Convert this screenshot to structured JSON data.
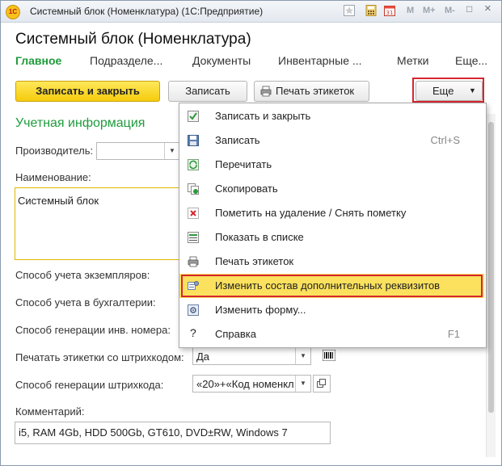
{
  "window": {
    "title": "Системный блок (Номенклатура)  (1С:Предприятие)",
    "toolbar_text": [
      "M",
      "M+",
      "M-"
    ],
    "window_buttons": [
      "□",
      "×"
    ]
  },
  "form": {
    "title": "Системный блок (Номенклатура)",
    "tabs": [
      "Главное",
      "Подразделе...",
      "Документы",
      "Инвентарные ...",
      "Метки",
      "Еще..."
    ]
  },
  "toolbar": {
    "save_close": "Записать и закрыть",
    "save": "Записать",
    "print_labels": "Печать этикеток",
    "more": "Еще"
  },
  "section": {
    "title": "Учетная информация"
  },
  "fields": {
    "manufacturer_label": "Производитель:",
    "name_label": "Наименование:",
    "name_value": "Системный блок",
    "copy_method_label": "Способ учета экземпляров:",
    "accounting_method_label": "Способ учета в бухгалтерии:",
    "inv_gen_label": "Способ генерации инв. номера:",
    "print_barcode_label": "Печатать этикетки со штрихкодом:",
    "print_barcode_value": "Да",
    "barcode_gen_label": "Способ генерации штрихкода:",
    "barcode_gen_value": "«20»+«Код номенкл",
    "comment_label": "Комментарий:",
    "comment_value": "i5, RAM 4Gb, HDD 500Gb, GT610, DVD±RW, Windows 7"
  },
  "menu": {
    "items": [
      {
        "label": "Записать и закрыть",
        "shortcut": "",
        "icon": "save-close-icon"
      },
      {
        "label": "Записать",
        "shortcut": "Ctrl+S",
        "icon": "floppy-icon"
      },
      {
        "label": "Перечитать",
        "shortcut": "",
        "icon": "reload-icon"
      },
      {
        "label": "Скопировать",
        "shortcut": "",
        "icon": "copy-icon"
      },
      {
        "label": "Пометить на удаление / Снять пометку",
        "shortcut": "",
        "icon": "delete-mark-icon"
      },
      {
        "label": "Показать в списке",
        "shortcut": "",
        "icon": "show-in-list-icon"
      },
      {
        "label": "Печать этикеток",
        "shortcut": "",
        "icon": "printer-icon"
      },
      {
        "label": "Изменить состав дополнительных реквизитов",
        "shortcut": "",
        "icon": "attributes-icon"
      },
      {
        "label": "Изменить форму...",
        "shortcut": "",
        "icon": "form-settings-icon"
      },
      {
        "label": "Справка",
        "shortcut": "F1",
        "icon": "help-icon"
      }
    ]
  },
  "colors": {
    "accent_green": "#1f9b3c",
    "highlight": "#fbe15e",
    "red_frame": "#d6262f",
    "primary_button": "#f5cb0c"
  }
}
